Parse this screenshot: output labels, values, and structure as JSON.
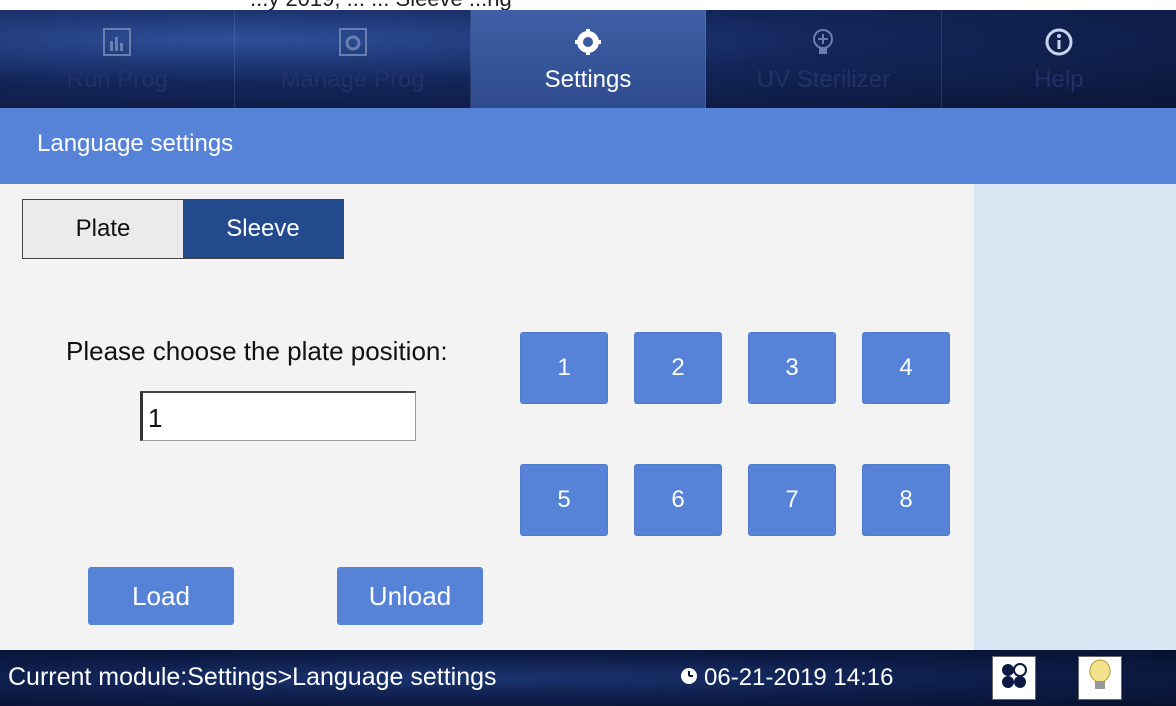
{
  "caption": "...y 2019, ...   ...  Sleeve  ...ng",
  "nav": {
    "items": [
      {
        "label": "Run Prog",
        "icon": "chart-icon"
      },
      {
        "label": "Manage Prog",
        "icon": "gear-window-icon"
      },
      {
        "label": "Settings",
        "icon": "gear-icon"
      },
      {
        "label": "UV Sterilizer",
        "icon": "bulb-icon"
      },
      {
        "label": "Help",
        "icon": "info-icon"
      }
    ],
    "active": "Settings"
  },
  "title": "Language settings",
  "segment": {
    "plate": "Plate",
    "sleeve": "Sleeve",
    "selected": "Sleeve"
  },
  "prompt": "Please choose the plate position:",
  "position_value": "1",
  "positions": [
    "1",
    "2",
    "3",
    "4",
    "5",
    "6",
    "7",
    "8"
  ],
  "actions": {
    "load": "Load",
    "unload": "Unload"
  },
  "status": {
    "module": "Current module:Settings>Language settings",
    "datetime": "06-21-2019 14:16"
  },
  "colors": {
    "accent": "#5683d8",
    "selected": "#234a8c",
    "nav_bg": "#13265a"
  }
}
